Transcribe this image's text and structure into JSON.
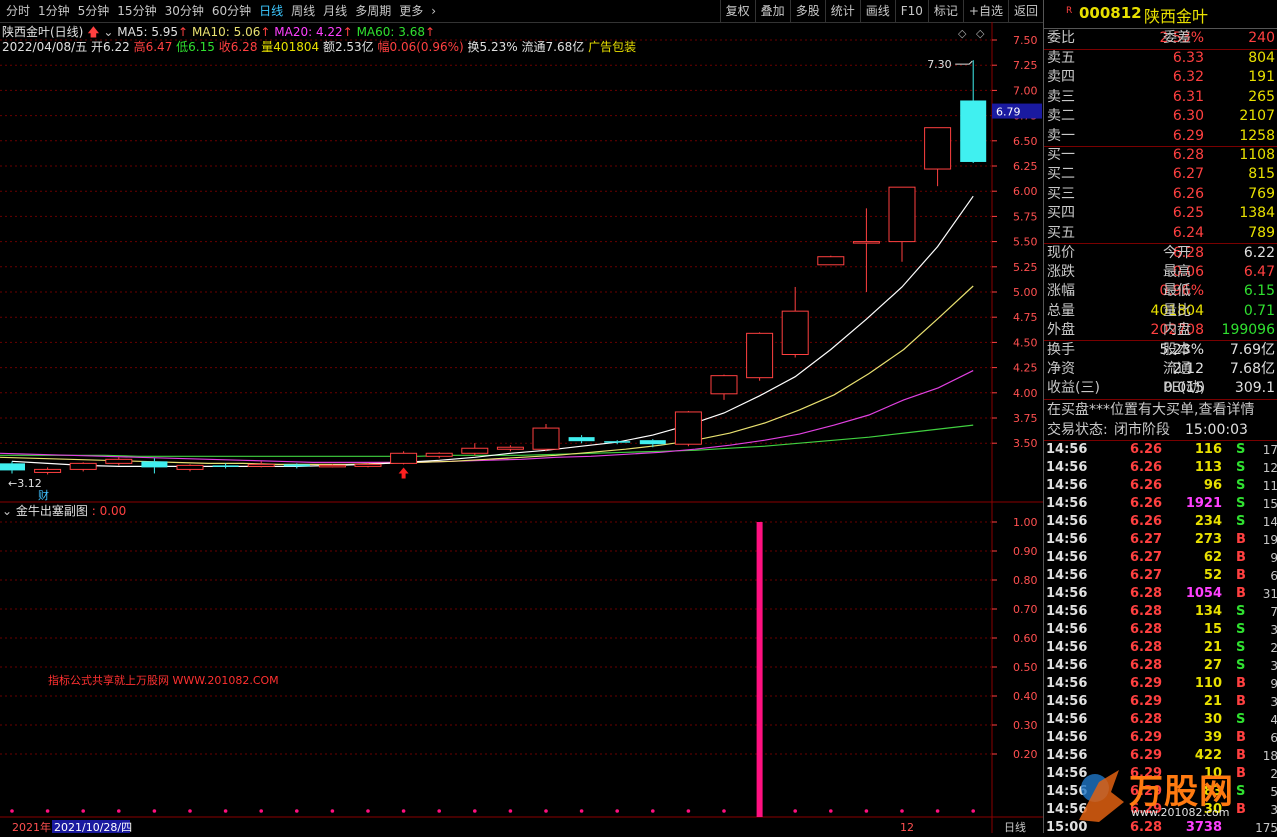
{
  "toolbar": {
    "tabs": [
      "分时",
      "1分钟",
      "5分钟",
      "15分钟",
      "30分钟",
      "60分钟",
      "日线",
      "周线",
      "月线",
      "多周期",
      "更多"
    ],
    "active_tab": "日线",
    "more_arrow": "›",
    "right_tools": [
      "复权",
      "叠加",
      "多股",
      "统计",
      "画线",
      "F10",
      "标记",
      "+自选",
      "返回"
    ]
  },
  "chart_header": {
    "name": "陕西金叶(日线)",
    "ma5": "MA5: 5.95",
    "ma10": "MA10: 5.06",
    "ma20": "MA20: 4.22",
    "ma60": "MA60: 3.68",
    "date": "2022/04/08/五",
    "open": "开6.22",
    "high": "高6.47",
    "low": "低6.15",
    "close": "收6.28",
    "volume": "量401804",
    "amount": "额2.53亿",
    "change": "幅0.06(0.96%)",
    "turnover": "换5.23%",
    "float": "流通7.68亿",
    "concept": "广告包装"
  },
  "main_axis": [
    "7.50",
    "7.25",
    "7.00",
    "6.75",
    "6.50",
    "6.25",
    "6.00",
    "5.75",
    "5.50",
    "5.25",
    "5.00",
    "4.75",
    "4.50",
    "4.25",
    "4.00",
    "3.75",
    "3.50"
  ],
  "current_price_tag": "6.79",
  "high_mark": "7.30",
  "low_mark": "3.12",
  "cai_mark": "财",
  "sub_chart": {
    "title": "金牛出塞副图",
    "value": ": 0.00",
    "axis": [
      "1.00",
      "0.90",
      "0.80",
      "0.70",
      "0.60",
      "0.50",
      "0.40",
      "0.30",
      "0.20"
    ],
    "watermark": "指标公式共享就上万股网 WWW.201082.COM"
  },
  "bottom_axis": {
    "year": "2021年",
    "date": "2021/10/28/四",
    "month_mark": "12",
    "period": "日线"
  },
  "colors": {
    "up": "#ff4040",
    "down": "#40f0f0",
    "ma5": "#ffffff",
    "ma10": "#e8e070",
    "ma20": "#e040e0",
    "ma60": "#40d040",
    "grid": "#6a0000"
  },
  "stock": {
    "code": "000812",
    "name": "陕西金叶",
    "r_badge": "R"
  },
  "order_ratio": {
    "label": "委比",
    "value": "2.53%",
    "label2": "委差",
    "value2": "240"
  },
  "asks": [
    {
      "label": "卖五",
      "price": "6.33",
      "vol": "804"
    },
    {
      "label": "卖四",
      "price": "6.32",
      "vol": "191"
    },
    {
      "label": "卖三",
      "price": "6.31",
      "vol": "265"
    },
    {
      "label": "卖二",
      "price": "6.30",
      "vol": "2107"
    },
    {
      "label": "卖一",
      "price": "6.29",
      "vol": "1258"
    }
  ],
  "bids": [
    {
      "label": "买一",
      "price": "6.28",
      "vol": "1108"
    },
    {
      "label": "买二",
      "price": "6.27",
      "vol": "815"
    },
    {
      "label": "买三",
      "price": "6.26",
      "vol": "769"
    },
    {
      "label": "买四",
      "price": "6.25",
      "vol": "1384"
    },
    {
      "label": "买五",
      "price": "6.24",
      "vol": "789"
    }
  ],
  "quote": [
    {
      "l1": "现价",
      "v1": "6.28",
      "c1": "red",
      "l2": "今开",
      "v2": "6.22",
      "c2": "white"
    },
    {
      "l1": "涨跌",
      "v1": "0.06",
      "c1": "red",
      "l2": "最高",
      "v2": "6.47",
      "c2": "red"
    },
    {
      "l1": "涨幅",
      "v1": "0.96%",
      "c1": "red",
      "l2": "最低",
      "v2": "6.15",
      "c2": "green"
    },
    {
      "l1": "总量",
      "v1": "401804",
      "c1": "yellow",
      "l2": "量比",
      "v2": "0.71",
      "c2": "green"
    },
    {
      "l1": "外盘",
      "v1": "202708",
      "c1": "red",
      "l2": "内盘",
      "v2": "199096",
      "c2": "green"
    }
  ],
  "fundamentals": [
    {
      "l1": "换手",
      "v1": "5.23%",
      "l2": "股本",
      "v2": "7.69亿"
    },
    {
      "l1": "净资",
      "v1": "2.12",
      "l2": "流通",
      "v2": "7.68亿"
    },
    {
      "l1": "收益(三)",
      "v1": "0.015",
      "l2": "PE(动)",
      "v2": "309.1"
    }
  ],
  "notice": "在买盘***位置有大买单,查看详情",
  "trade_status": {
    "label": "交易状态:",
    "value": "闭市阶段",
    "time": "15:00:03"
  },
  "ticks": [
    {
      "t": "14:56",
      "p": "6.26",
      "v": "116",
      "d": "S",
      "n": "17"
    },
    {
      "t": "14:56",
      "p": "6.26",
      "v": "113",
      "d": "S",
      "n": "12"
    },
    {
      "t": "14:56",
      "p": "6.26",
      "v": "96",
      "d": "S",
      "n": "11"
    },
    {
      "t": "14:56",
      "p": "6.26",
      "v": "1921",
      "d": "S",
      "n": "15"
    },
    {
      "t": "14:56",
      "p": "6.26",
      "v": "234",
      "d": "S",
      "n": "14"
    },
    {
      "t": "14:56",
      "p": "6.27",
      "v": "273",
      "d": "B",
      "n": "19"
    },
    {
      "t": "14:56",
      "p": "6.27",
      "v": "62",
      "d": "B",
      "n": "9"
    },
    {
      "t": "14:56",
      "p": "6.27",
      "v": "52",
      "d": "B",
      "n": "6"
    },
    {
      "t": "14:56",
      "p": "6.28",
      "v": "1054",
      "d": "B",
      "n": "31"
    },
    {
      "t": "14:56",
      "p": "6.28",
      "v": "134",
      "d": "S",
      "n": "7"
    },
    {
      "t": "14:56",
      "p": "6.28",
      "v": "15",
      "d": "S",
      "n": "3"
    },
    {
      "t": "14:56",
      "p": "6.28",
      "v": "21",
      "d": "S",
      "n": "2"
    },
    {
      "t": "14:56",
      "p": "6.28",
      "v": "27",
      "d": "S",
      "n": "3"
    },
    {
      "t": "14:56",
      "p": "6.29",
      "v": "110",
      "d": "B",
      "n": "9"
    },
    {
      "t": "14:56",
      "p": "6.29",
      "v": "21",
      "d": "B",
      "n": "3"
    },
    {
      "t": "14:56",
      "p": "6.28",
      "v": "30",
      "d": "S",
      "n": "4"
    },
    {
      "t": "14:56",
      "p": "6.29",
      "v": "39",
      "d": "B",
      "n": "6"
    },
    {
      "t": "14:56",
      "p": "6.29",
      "v": "422",
      "d": "B",
      "n": "18"
    },
    {
      "t": "14:56",
      "p": "6.29",
      "v": "10",
      "d": "B",
      "n": "2"
    },
    {
      "t": "14:56",
      "p": "6.29",
      "v": "83",
      "d": "S",
      "n": "5"
    },
    {
      "t": "14:56",
      "p": "6.29",
      "v": "30",
      "d": "B",
      "n": "3"
    },
    {
      "t": "15:00",
      "p": "6.28",
      "v": "3738",
      "d": "",
      "n": "175"
    }
  ],
  "logo": {
    "brand": "万股网",
    "url": "www.201082.com"
  },
  "chart_data": {
    "type": "candlestick",
    "ylim": [
      3.0,
      7.6
    ],
    "candles": [
      {
        "o": 3.3,
        "c": 3.23,
        "h": 3.32,
        "l": 3.2
      },
      {
        "o": 3.21,
        "c": 3.24,
        "h": 3.26,
        "l": 3.19
      },
      {
        "o": 3.24,
        "c": 3.3,
        "h": 3.31,
        "l": 3.22
      },
      {
        "o": 3.3,
        "c": 3.34,
        "h": 3.36,
        "l": 3.28
      },
      {
        "o": 3.32,
        "c": 3.26,
        "h": 3.35,
        "l": 3.2
      },
      {
        "o": 3.24,
        "c": 3.28,
        "h": 3.29,
        "l": 3.22
      },
      {
        "o": 3.28,
        "c": 3.27,
        "h": 3.3,
        "l": 3.25
      },
      {
        "o": 3.27,
        "c": 3.29,
        "h": 3.32,
        "l": 3.26
      },
      {
        "o": 3.29,
        "c": 3.27,
        "h": 3.3,
        "l": 3.25
      },
      {
        "o": 3.27,
        "c": 3.28,
        "h": 3.29,
        "l": 3.26
      },
      {
        "o": 3.27,
        "c": 3.29,
        "h": 3.3,
        "l": 3.26
      },
      {
        "o": 3.3,
        "c": 3.4,
        "h": 3.42,
        "l": 3.29
      },
      {
        "o": 3.37,
        "c": 3.4,
        "h": 3.41,
        "l": 3.35
      },
      {
        "o": 3.4,
        "c": 3.45,
        "h": 3.5,
        "l": 3.38
      },
      {
        "o": 3.44,
        "c": 3.46,
        "h": 3.48,
        "l": 3.42
      },
      {
        "o": 3.44,
        "c": 3.65,
        "h": 3.69,
        "l": 3.42
      },
      {
        "o": 3.56,
        "c": 3.52,
        "h": 3.58,
        "l": 3.5
      },
      {
        "o": 3.52,
        "c": 3.51,
        "h": 3.53,
        "l": 3.49
      },
      {
        "o": 3.53,
        "c": 3.49,
        "h": 3.54,
        "l": 3.46
      },
      {
        "o": 3.49,
        "c": 3.81,
        "h": 3.82,
        "l": 3.47
      },
      {
        "o": 3.99,
        "c": 4.17,
        "h": 4.18,
        "l": 3.93
      },
      {
        "o": 4.15,
        "c": 4.59,
        "h": 4.6,
        "l": 4.12
      },
      {
        "o": 4.38,
        "c": 4.81,
        "h": 5.05,
        "l": 4.35
      },
      {
        "o": 5.27,
        "c": 5.35,
        "h": 5.36,
        "l": 5.27
      },
      {
        "o": 5.5,
        "c": 5.5,
        "h": 5.83,
        "l": 5.0
      },
      {
        "o": 5.5,
        "c": 6.04,
        "h": 6.04,
        "l": 5.3
      },
      {
        "o": 6.22,
        "c": 6.63,
        "h": 6.63,
        "l": 6.05
      },
      {
        "o": 6.9,
        "c": 6.29,
        "h": 7.3,
        "l": 6.28
      }
    ],
    "ma5": [
      3.32,
      3.3,
      3.28,
      3.27,
      3.27,
      3.27,
      3.27,
      3.27,
      3.27,
      3.28,
      3.29,
      3.31,
      3.33,
      3.36,
      3.4,
      3.43,
      3.47,
      3.51,
      3.58,
      3.68,
      3.8,
      3.97,
      4.16,
      4.43,
      4.73,
      5.05,
      5.45,
      5.95
    ],
    "ma10": [
      3.36,
      3.35,
      3.34,
      3.33,
      3.32,
      3.31,
      3.3,
      3.3,
      3.29,
      3.29,
      3.29,
      3.3,
      3.31,
      3.32,
      3.34,
      3.36,
      3.38,
      3.41,
      3.44,
      3.48,
      3.53,
      3.6,
      3.7,
      3.83,
      3.98,
      4.19,
      4.43,
      4.74,
      5.06
    ],
    "ma20": [
      3.4,
      3.39,
      3.38,
      3.37,
      3.36,
      3.35,
      3.34,
      3.33,
      3.32,
      3.31,
      3.31,
      3.31,
      3.31,
      3.32,
      3.33,
      3.34,
      3.36,
      3.37,
      3.39,
      3.41,
      3.44,
      3.48,
      3.53,
      3.59,
      3.68,
      3.78,
      3.93,
      4.05,
      4.22
    ],
    "ma60": [
      3.38,
      3.38,
      3.38,
      3.38,
      3.37,
      3.37,
      3.37,
      3.37,
      3.37,
      3.37,
      3.37,
      3.37,
      3.37,
      3.38,
      3.38,
      3.38,
      3.39,
      3.4,
      3.41,
      3.42,
      3.43,
      3.45,
      3.47,
      3.5,
      3.53,
      3.56,
      3.6,
      3.64,
      3.68
    ],
    "signal_index": 21,
    "sub_ylim": [
      0,
      1.0
    ],
    "sub_signal_value": 1.0
  }
}
